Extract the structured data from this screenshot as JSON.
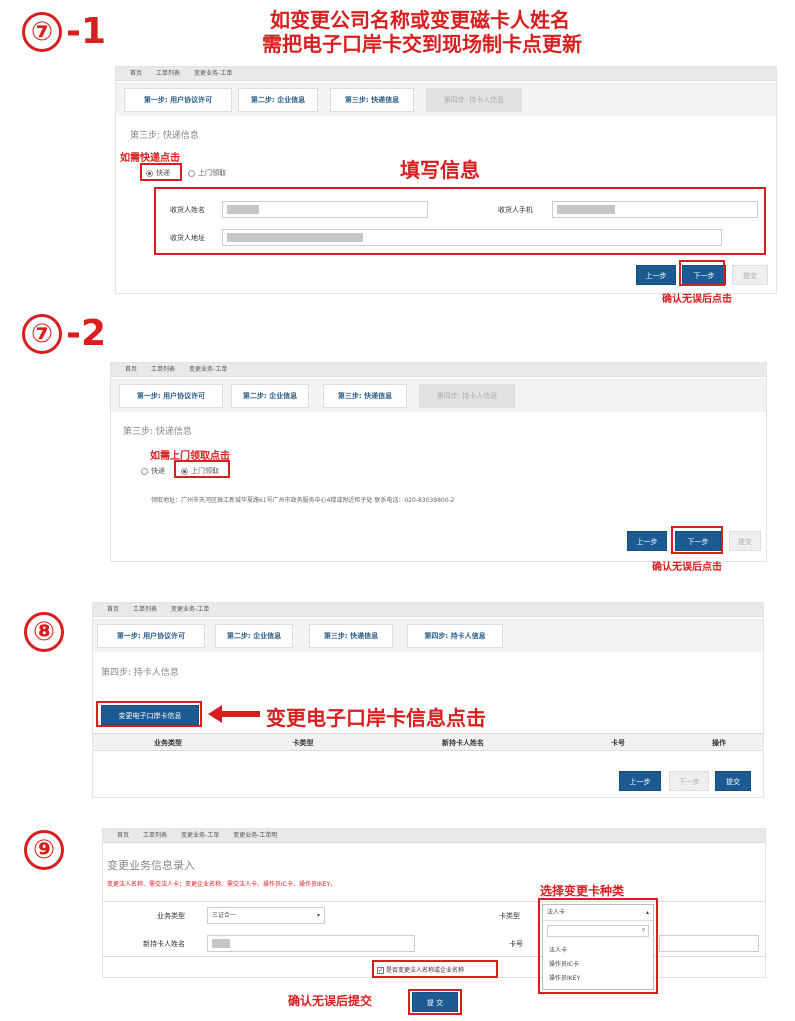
{
  "header": {
    "title_line1": "如变更公司名称或变更磁卡人姓名",
    "title_line2": "需把电子口岸卡交到现场制卡点更新"
  },
  "crumbs": [
    "首页",
    "工单列表",
    "变更业务-工单"
  ],
  "tabs": [
    "第一步: 用户协议许可",
    "第二步: 企业信息",
    "第三步: 快递信息",
    "第四步: 持卡人信息"
  ],
  "buttons": {
    "prev": "上一步",
    "next": "下一步",
    "submit": "提交"
  },
  "s71": {
    "step_num": "⑦",
    "step_suffix": "-1",
    "subhead": "第三步: 快递信息",
    "note_express": "如需快递点击",
    "opt_express": "快递",
    "opt_pickup": "上门领取",
    "fill_note": "填写信息",
    "label_name": "收货人姓名",
    "label_phone": "收货人手机",
    "label_address": "收货人地址",
    "confirm_note": "确认无误后点击"
  },
  "s72": {
    "step_num": "⑦",
    "step_suffix": "-2",
    "subhead": "第三步: 快递信息",
    "note_pickup": "如需上门领取点击",
    "opt_express": "快递",
    "opt_pickup": "上门领取",
    "address_text": "领取地址：广州市天河区珠江新城华夏路61号广州市政务服务中心4楼或附近柜子处   联系电话：020-83039800-2",
    "confirm_note": "确认无误后点击"
  },
  "s8": {
    "step_num": "⑧",
    "subhead": "第四步: 持卡人信息",
    "change_btn": "变更电子口岸卡信息",
    "arrow_note": "变更电子口岸卡信息点击",
    "table_headers": [
      "业务类型",
      "卡类型",
      "新持卡人姓名",
      "卡号",
      "操作"
    ]
  },
  "s9": {
    "step_num": "⑨",
    "crumbs": [
      "首页",
      "工单列表",
      "变更业务-工单",
      "变更业务-工单明"
    ],
    "title": "变更业务信息录入",
    "notice": "变更法人名称、需交法人卡；变更企业名称、需交法人卡、操作员IC卡、操作员IKEY。",
    "label_type": "业务类型",
    "type_value": "三证合一",
    "label_card_type": "卡类型",
    "card_type_value": "法人卡",
    "label_new_holder": "新持卡人姓名",
    "label_card_no": "卡号",
    "checkbox_label": "是否变更法人名称或企业名称",
    "select_note": "选择变更卡种类",
    "dropdown_options": [
      "法人卡",
      "操作员IC卡",
      "操作员IKEY"
    ],
    "confirm_note": "确认无误后提交",
    "submit": "提 交"
  },
  "colors": {
    "accent_red": "#d81e1e",
    "button_blue": "#1b5b92"
  }
}
